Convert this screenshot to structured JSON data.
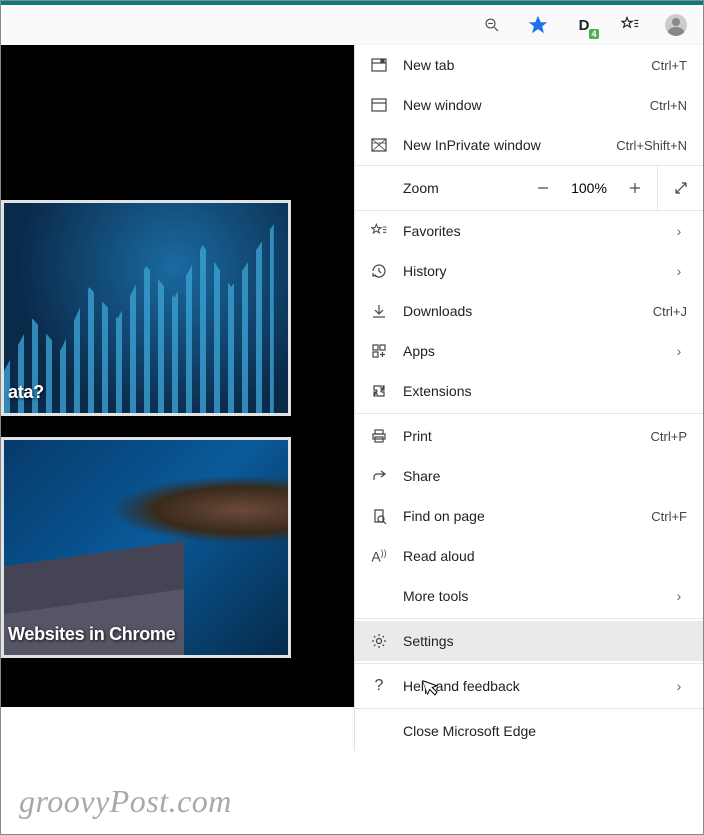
{
  "toolbar": {
    "ext_badge": "4"
  },
  "tiles": {
    "t1": "ata?",
    "t2": "Websites in Chrome"
  },
  "menu": {
    "new_tab": {
      "label": "New tab",
      "shortcut": "Ctrl+T"
    },
    "new_window": {
      "label": "New window",
      "shortcut": "Ctrl+N"
    },
    "new_inprivate": {
      "label": "New InPrivate window",
      "shortcut": "Ctrl+Shift+N"
    },
    "zoom": {
      "label": "Zoom",
      "value": "100%"
    },
    "favorites": {
      "label": "Favorites"
    },
    "history": {
      "label": "History"
    },
    "downloads": {
      "label": "Downloads",
      "shortcut": "Ctrl+J"
    },
    "apps": {
      "label": "Apps"
    },
    "extensions": {
      "label": "Extensions"
    },
    "print": {
      "label": "Print",
      "shortcut": "Ctrl+P"
    },
    "share": {
      "label": "Share"
    },
    "find": {
      "label": "Find on page",
      "shortcut": "Ctrl+F"
    },
    "read_aloud": {
      "label": "Read aloud"
    },
    "more_tools": {
      "label": "More tools"
    },
    "settings": {
      "label": "Settings"
    },
    "help": {
      "label": "Help and feedback"
    },
    "close": {
      "label": "Close Microsoft Edge"
    }
  },
  "watermark": "groovyPost.com"
}
